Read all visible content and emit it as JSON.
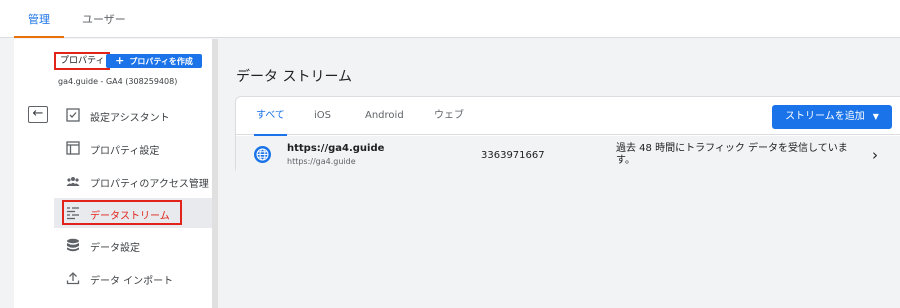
{
  "top_tabs": {
    "admin": "管理",
    "user": "ユーザー"
  },
  "sidebar": {
    "property_label": "プロパティ",
    "create_button": "プロパティを作成",
    "create_plus": "+",
    "property_sub": "ga4.guide - GA4 (308259408)",
    "back_arrow": "←",
    "items": [
      {
        "label": "設定アシスタント",
        "icon": "checklist-icon"
      },
      {
        "label": "プロパティ設定",
        "icon": "property-settings-icon"
      },
      {
        "label": "プロパティのアクセス管理",
        "icon": "people-icon"
      },
      {
        "label": "データストリーム",
        "icon": "data-stream-icon"
      },
      {
        "label": "データ設定",
        "icon": "database-icon"
      },
      {
        "label": "データ インポート",
        "icon": "upload-icon"
      }
    ]
  },
  "main": {
    "title": "データ ストリーム",
    "tabs": [
      "すべて",
      "iOS",
      "Android",
      "ウェブ"
    ],
    "add_button": "ストリームを追加",
    "add_caret": "▼",
    "stream": {
      "name": "https://ga4.guide",
      "url": "https://ga4.guide",
      "id": "3363971667",
      "status": "過去 48 時間にトラフィック データを受信しています。",
      "chevron": "›"
    }
  },
  "colors": {
    "accent": "#1a73e8",
    "highlight": "#e2231a",
    "tab_underline": "#e8710a"
  }
}
